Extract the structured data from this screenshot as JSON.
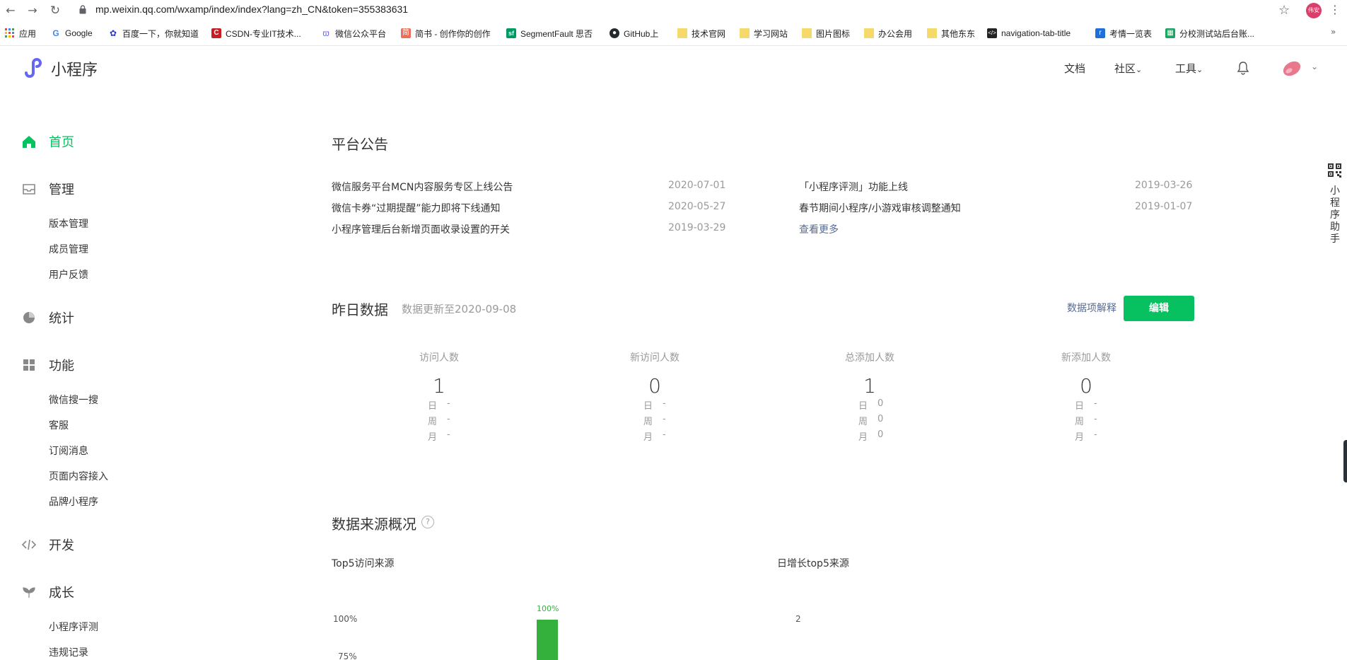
{
  "browser": {
    "url": "mp.weixin.qq.com/wxamp/index/index?lang=zh_CN&token=355383631",
    "profile_name": "伟安",
    "bookmarks": [
      {
        "label": "应用",
        "icon": "apps-grid-icon"
      },
      {
        "label": "Google",
        "icon": "google-icon"
      },
      {
        "label": "百度一下，你就知道",
        "icon": "baidu-icon"
      },
      {
        "label": "CSDN-专业IT技术...",
        "icon": "csdn-icon"
      },
      {
        "label": "微信公众平台",
        "icon": "miniprogram-icon"
      },
      {
        "label": "简书 - 创作你的创作",
        "icon": "jianshu-icon"
      },
      {
        "label": "SegmentFault 思否",
        "icon": "segmentfault-icon"
      },
      {
        "label": "GitHub上",
        "icon": "github-icon"
      },
      {
        "label": "技术官网",
        "icon": "folder-icon"
      },
      {
        "label": "学习网站",
        "icon": "folder-icon"
      },
      {
        "label": "图片图标",
        "icon": "folder-icon"
      },
      {
        "label": "办公会用",
        "icon": "folder-icon"
      },
      {
        "label": "其他东东",
        "icon": "folder-icon"
      },
      {
        "label": "navigation-tab-title",
        "icon": "code-icon"
      },
      {
        "label": "考情一览表",
        "icon": "kaoqing-icon"
      },
      {
        "label": "分校测试站后台账...",
        "icon": "sheet-icon"
      }
    ]
  },
  "header": {
    "title": "小程序",
    "links": {
      "docs": "文档",
      "community": "社区",
      "tools": "工具"
    }
  },
  "sidebar": {
    "home": "首页",
    "manage": {
      "label": "管理",
      "items": [
        "版本管理",
        "成员管理",
        "用户反馈"
      ]
    },
    "stats": "统计",
    "features": {
      "label": "功能",
      "items": [
        "微信搜一搜",
        "客服",
        "订阅消息",
        "页面内容接入",
        "品牌小程序"
      ]
    },
    "dev": "开发",
    "growth": {
      "label": "成长",
      "items": [
        "小程序评测",
        "违规记录"
      ]
    }
  },
  "announcements": {
    "title": "平台公告",
    "left": [
      {
        "text": "微信服务平台MCN内容服务专区上线公告",
        "date": "2020-07-01"
      },
      {
        "text": "微信卡券“过期提醒”能力即将下线通知",
        "date": "2020-05-27"
      },
      {
        "text": "小程序管理后台新增页面收录设置的开关",
        "date": "2019-03-29"
      }
    ],
    "right": [
      {
        "text": "「小程序评测」功能上线",
        "date": "2019-03-26"
      },
      {
        "text": "春节期间小程序/小游戏审核调整通知",
        "date": "2019-01-07"
      }
    ],
    "more": "查看更多"
  },
  "yesterday": {
    "title": "昨日数据",
    "update_note": "数据更新至2020-09-08",
    "explain": "数据项解释",
    "edit": "编辑",
    "row_labels": [
      "日",
      "周",
      "月"
    ],
    "stats": [
      {
        "label": "访问人数",
        "value": "1",
        "rows": [
          "-",
          "-",
          "-"
        ]
      },
      {
        "label": "新访问人数",
        "value": "0",
        "rows": [
          "-",
          "-",
          "-"
        ]
      },
      {
        "label": "总添加人数",
        "value": "1",
        "rows": [
          "0",
          "0",
          "0"
        ]
      },
      {
        "label": "新添加人数",
        "value": "0",
        "rows": [
          "-",
          "-",
          "-"
        ]
      }
    ]
  },
  "sources": {
    "title": "数据来源概况",
    "help": "?"
  },
  "chart_data": [
    {
      "type": "bar",
      "title": "Top5访问来源",
      "y_ticks": [
        "100%",
        "75%"
      ],
      "bar_label": "100%",
      "values": [
        100
      ],
      "color": "#33b13c"
    },
    {
      "type": "bar",
      "title": "日增长top5来源",
      "y_ticks": [
        "2"
      ]
    }
  ],
  "assistant": {
    "label": "小程序助手"
  },
  "colors": {
    "accent": "#07c160",
    "link": "#576b95",
    "muted": "#9a9a9a"
  }
}
